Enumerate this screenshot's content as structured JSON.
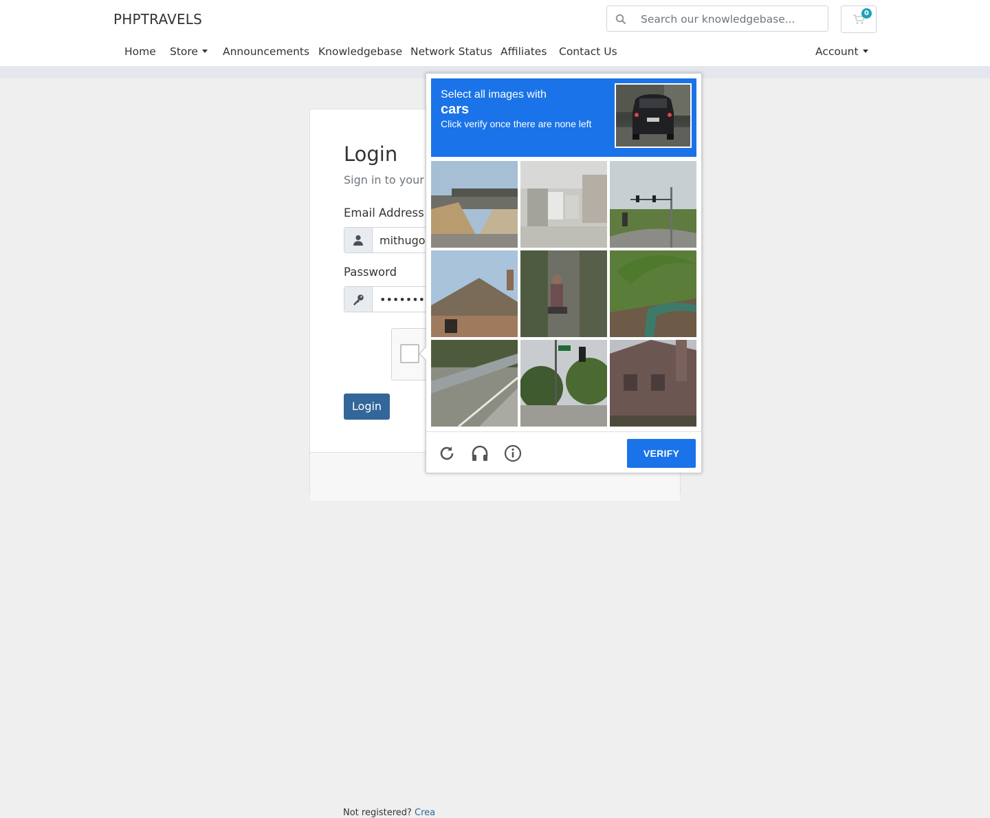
{
  "header": {
    "brand": "PHPTRAVELS",
    "search_placeholder": "Search our knowledgebase...",
    "cart_count": "0",
    "nav": {
      "home": "Home",
      "store": "Store",
      "announcements": "Announcements",
      "knowledgebase": "Knowledgebase",
      "network_status": "Network Status",
      "affiliates": "Affiliates",
      "contact_us": "Contact Us",
      "account": "Account"
    }
  },
  "login": {
    "title": "Login",
    "subtitle": "Sign in to your a",
    "email_label": "Email Address",
    "email_value": "mithugop",
    "password_label": "Password",
    "password_value": "•••••••••••",
    "submit_label": "Login",
    "footer_text": "Not registered?",
    "footer_link": "Crea"
  },
  "captcha": {
    "instruction_line1": "Select all images with",
    "instruction_target": "cars",
    "instruction_line3": "Click verify once there are none left",
    "verify_label": "VERIFY",
    "tiles": [
      "bridge-overpass",
      "street-with-bus",
      "traffic-lights-road",
      "house-roof",
      "person-on-street",
      "grass-palm",
      "road-guardrail",
      "traffic-light-trees",
      "brick-building"
    ],
    "icons": [
      "reload-icon",
      "audio-icon",
      "info-icon"
    ]
  },
  "colors": {
    "captcha_blue": "#1a73e8",
    "login_button": "#336699",
    "cart_badge": "#17a2b8"
  }
}
